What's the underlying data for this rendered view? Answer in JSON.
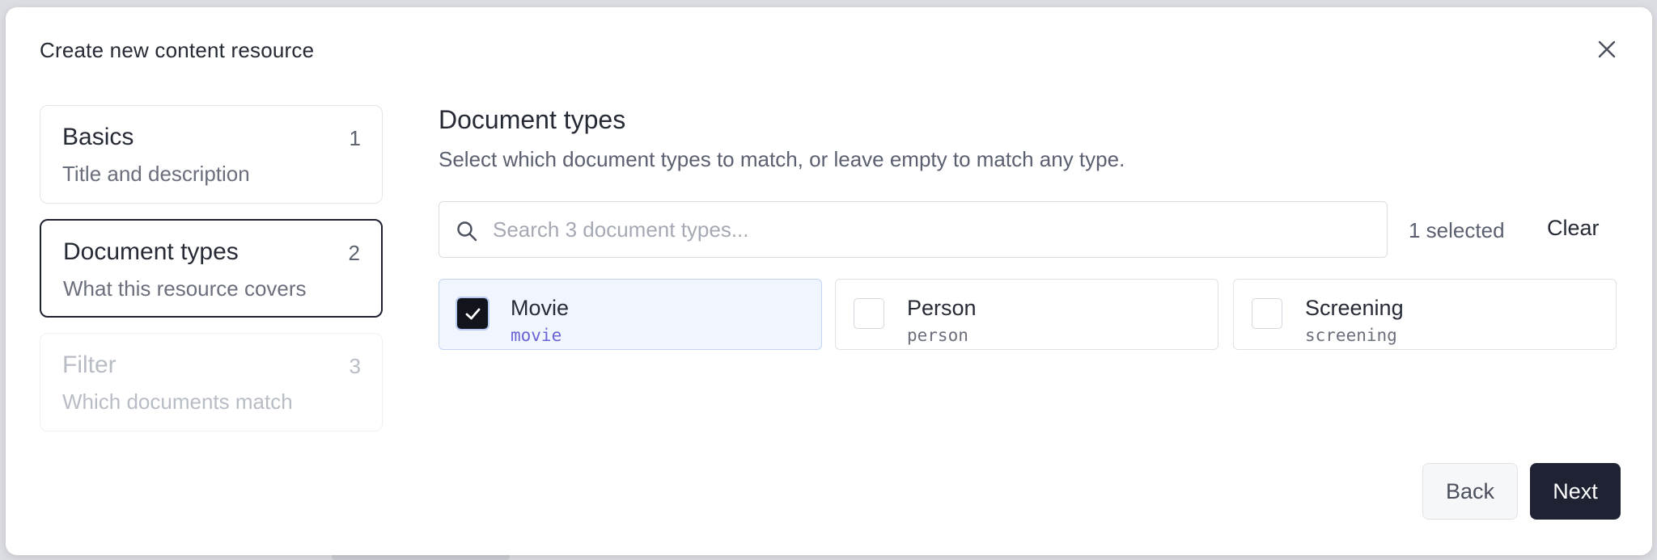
{
  "dialog": {
    "title": "Create new content resource"
  },
  "steps": [
    {
      "title": "Basics",
      "subtitle": "Title and description",
      "number": "1",
      "state": "complete"
    },
    {
      "title": "Document types",
      "subtitle": "What this resource covers",
      "number": "2",
      "state": "active"
    },
    {
      "title": "Filter",
      "subtitle": "Which documents match",
      "number": "3",
      "state": "disabled"
    }
  ],
  "main": {
    "title": "Document types",
    "description": "Select which document types to match, or leave empty to match any type.",
    "search": {
      "placeholder": "Search 3 document types...",
      "value": ""
    },
    "selected_count": "1 selected",
    "clear_label": "Clear",
    "types": [
      {
        "name": "Movie",
        "id": "movie",
        "checked": true
      },
      {
        "name": "Person",
        "id": "person",
        "checked": false
      },
      {
        "name": "Screening",
        "id": "screening",
        "checked": false
      }
    ]
  },
  "footer": {
    "back_label": "Back",
    "next_label": "Next"
  },
  "colors": {
    "primary": "#1e2232",
    "selected_bg": "#f1f5fd",
    "id_accent": "#6a63d6"
  }
}
